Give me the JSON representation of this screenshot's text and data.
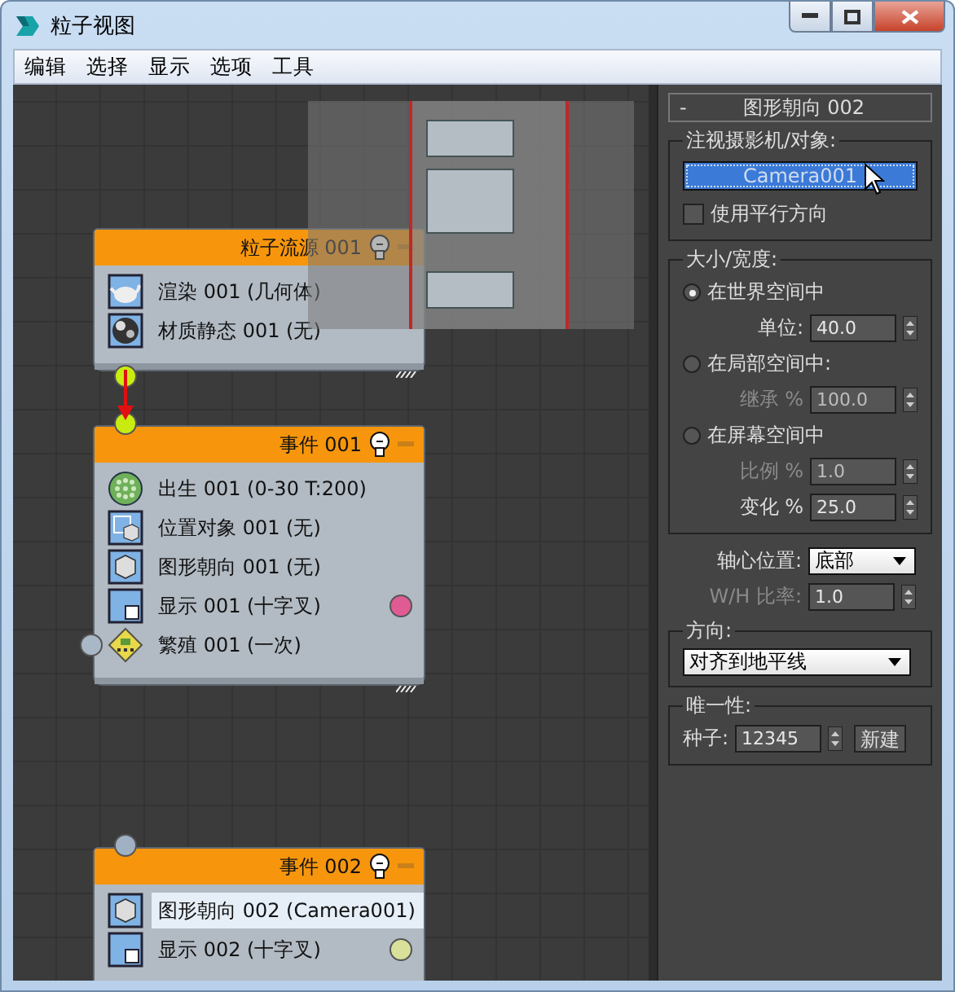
{
  "window": {
    "title": "粒子视图"
  },
  "menu": [
    {
      "label": "编辑"
    },
    {
      "label": "选择"
    },
    {
      "label": "显示"
    },
    {
      "label": "选项"
    },
    {
      "label": "工具"
    }
  ],
  "nodes": [
    {
      "title": "粒子流源 001",
      "output": {
        "linked": true
      },
      "operators": [
        {
          "kind": "render",
          "label": "渲染 001 (几何体)",
          "selected": false
        },
        {
          "kind": "material",
          "label": "材质静态 001 (无)",
          "selected": false
        }
      ]
    },
    {
      "title": "事件 001",
      "input": {
        "linked": true
      },
      "operators": [
        {
          "kind": "birth",
          "label": "出生 001 (0-30 T:200)",
          "selected": false
        },
        {
          "kind": "position",
          "label": "位置对象 001 (无)",
          "selected": false
        },
        {
          "kind": "shape",
          "label": "图形朝向 001 (无)",
          "selected": false
        },
        {
          "kind": "display",
          "label": "显示 001 (十字叉)",
          "selected": false,
          "color": "#e05b94"
        },
        {
          "kind": "spawn",
          "label": "繁殖 001 (一次)",
          "selected": false
        }
      ]
    },
    {
      "title": "事件 002",
      "input": {
        "linked": false
      },
      "operators": [
        {
          "kind": "shape",
          "label": "图形朝向 002 (Camera001)",
          "selected": true
        },
        {
          "kind": "display",
          "label": "显示 002 (十字叉)",
          "selected": false,
          "color": "#d8e09a"
        }
      ]
    }
  ],
  "panel": {
    "collapse": "-",
    "title": "图形朝向 002",
    "look_at": {
      "legend": "注视摄影机/对象:",
      "button": "Camera001",
      "button_selected": true,
      "checkbox": {
        "label": "使用平行方向",
        "checked": false
      }
    },
    "size": {
      "legend": "大小/宽度:",
      "items": [
        {
          "kind": "radio",
          "label": "在世界空间中",
          "selected": true
        },
        {
          "kind": "spinner",
          "label": "单位:",
          "value": "40.0",
          "disabled": false
        },
        {
          "kind": "radio",
          "label": "在局部空间中:",
          "selected": false
        },
        {
          "kind": "spinner",
          "label": "继承 %",
          "value": "100.0",
          "disabled": true
        },
        {
          "kind": "radio",
          "label": "在屏幕空间中",
          "selected": false
        },
        {
          "kind": "spinner",
          "label": "比例 %",
          "value": "1.0",
          "disabled": true
        },
        {
          "kind": "spinner",
          "label": "变化 %",
          "value": "25.0",
          "disabled": false
        }
      ]
    },
    "pivot": {
      "label": "轴心位置:",
      "value": "底部"
    },
    "ratio": {
      "label": "W/H 比率:",
      "value": "1.0",
      "disabled": true
    },
    "orientation": {
      "legend": "方向:",
      "value": "对齐到地平线"
    },
    "uniqueness": {
      "legend": "唯一性:",
      "label": "种子:",
      "value": "12345",
      "button": "新建"
    }
  }
}
